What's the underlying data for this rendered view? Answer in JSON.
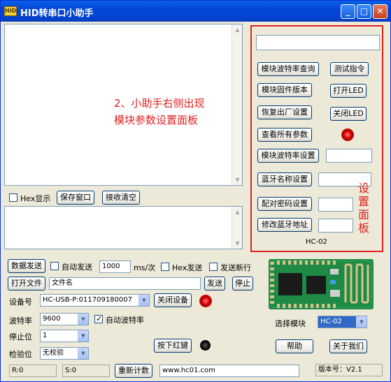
{
  "window": {
    "title": "HID转串口小助手",
    "icon_text": "HID"
  },
  "note": {
    "line1": "2、小助手右侧出现",
    "line2": "模块参数设置面板"
  },
  "side_label": [
    "设",
    "置",
    "面",
    "板"
  ],
  "receive_bar": {
    "hex_display": "Hex显示",
    "save_window": "保存窗口",
    "clear_receive": "接收清空"
  },
  "settings_panel": {
    "query_baud": "模块波特率查询",
    "test_cmd": "测试指令",
    "firmware": "模块固件版本",
    "open_led": "打开LED",
    "restore_factory": "恢复出厂设置",
    "close_led": "关闭LED",
    "view_all": "查看所有参数",
    "set_baud": "模块波特率设置",
    "set_bt_name": "蓝牙名称设置",
    "set_pair_pwd": "配对密码设置",
    "change_bt_addr": "修改蓝牙地址",
    "footer": "HC-02"
  },
  "controls": {
    "send_data": "数据发送",
    "auto_send": "自动发送",
    "interval_value": "1000",
    "interval_unit": "ms/次",
    "hex_send": "Hex发送",
    "send_newline": "发送新行",
    "open_file": "打开文件",
    "file_name": "文件名",
    "send": "发送",
    "stop": "停止",
    "device_label": "设备号",
    "device_value": "HC-USB-P:011709180007",
    "close_device": "关闭设备",
    "baud_label": "波特率",
    "baud_value": "9600",
    "auto_baud": "自动波特率",
    "stop_bits_label": "停止位",
    "stop_bits_value": "1",
    "parity_label": "检验位",
    "parity_value": "无校验",
    "press_red_key": "按下红键",
    "select_module": "选择模块",
    "module_value": "HC-02",
    "help": "帮助",
    "about_us": "关于我们"
  },
  "status": {
    "rx": "R:0",
    "tx": "S:0",
    "reset_count": "重新计数",
    "website": "www.hc01.com",
    "version": "版本号：V2.1"
  },
  "colors": {
    "accent_red": "#e02020",
    "title_blue": "#0246d8",
    "pcb_green": "#1e8a46"
  }
}
